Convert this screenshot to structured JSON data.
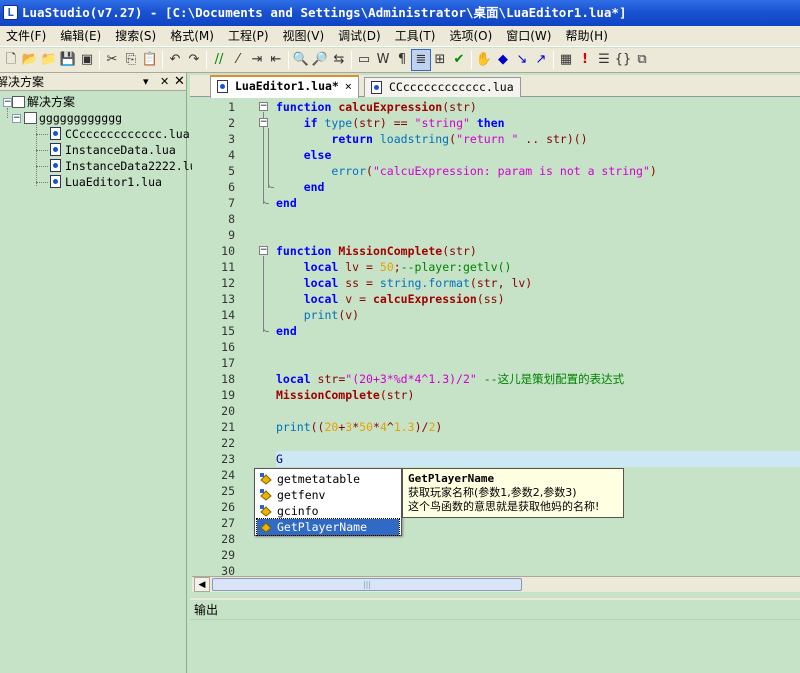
{
  "window": {
    "title": "LuaStudio(v7.27) - [C:\\Documents and Settings\\Administrator\\桌面\\LuaEditor1.lua*]"
  },
  "menu": [
    {
      "label": "文件(F)",
      "name": "menu-file"
    },
    {
      "label": "编辑(E)",
      "name": "menu-edit"
    },
    {
      "label": "搜索(S)",
      "name": "menu-search"
    },
    {
      "label": "格式(M)",
      "name": "menu-format"
    },
    {
      "label": "工程(P)",
      "name": "menu-project"
    },
    {
      "label": "视图(V)",
      "name": "menu-view"
    },
    {
      "label": "调试(D)",
      "name": "menu-debug"
    },
    {
      "label": "工具(T)",
      "name": "menu-tools"
    },
    {
      "label": "选项(O)",
      "name": "menu-options"
    },
    {
      "label": "窗口(W)",
      "name": "menu-window"
    },
    {
      "label": "帮助(H)",
      "name": "menu-help"
    }
  ],
  "toolbar_icons": [
    "new-file-icon",
    "open-folder-icon",
    "open-project-icon",
    "save-icon",
    "save-all-icon",
    "cut-icon",
    "copy-icon",
    "paste-icon",
    "undo-icon",
    "redo-icon",
    "comment-icon",
    "uncomment-icon",
    "indent-icon",
    "outdent-icon",
    "find-icon",
    "find-next-icon",
    "replace-icon",
    "monitor-icon",
    "word-wrap-icon",
    "whitespace-icon",
    "toggle-view-icon",
    "tree-icon",
    "check-icon",
    "hand-icon",
    "breakpoint-icon",
    "step-icon",
    "step-over-icon",
    "stack-icon",
    "exclamation-icon",
    "list-icon",
    "brace-icon",
    "window-icon"
  ],
  "solution_panel": {
    "title": "解决方案",
    "pin": "▾",
    "close": "✕",
    "root_label": "解决方案",
    "project": "gggggggggggg",
    "files": [
      "CCcccccccccccc.lua",
      "InstanceData.lua",
      "InstanceData2222.lua",
      "LuaEditor1.lua"
    ]
  },
  "tabs": [
    {
      "label": "LuaEditor1.lua*",
      "close": "×",
      "active": true
    },
    {
      "label": "CCcccccccccccc.lua",
      "active": false
    }
  ],
  "line_numbers": [
    "1",
    "2",
    "3",
    "4",
    "5",
    "6",
    "7",
    "8",
    "9",
    "10",
    "11",
    "12",
    "13",
    "14",
    "15",
    "16",
    "17",
    "18",
    "19",
    "20",
    "21",
    "22",
    "23",
    "24",
    "25",
    "26",
    "27",
    "28",
    "29",
    "30"
  ],
  "code": {
    "l1": {
      "kw": "function",
      "fn": "calcuExpression",
      "args": "(str)"
    },
    "l2": {
      "kw1": "if",
      "bi": "type",
      "p1": "(str) ",
      "op": "==",
      "sp": " ",
      "str": "\"string\"",
      "kw2": "then"
    },
    "l3": {
      "kw": "return",
      "bi": "loadstring",
      "p1": "(",
      "str": "\"return \"",
      "p2": " .. str)()"
    },
    "l4": {
      "kw": "else"
    },
    "l5": {
      "bi": "error",
      "p1": "(",
      "str": "\"calcuExpression: param is not a string\"",
      "p2": ")"
    },
    "l6": {
      "kw": "end"
    },
    "l7": {
      "kw": "end"
    },
    "l10": {
      "kw": "function",
      "fn": "MissionComplete",
      "args": "(str)"
    },
    "l11": {
      "kw": "local",
      "v": " lv ",
      "op": "=",
      "num": " 50",
      "p": ";",
      "cm": "--player:getlv()"
    },
    "l12": {
      "kw": "local",
      "v": " ss ",
      "op": "=",
      "bi": " string.format",
      "args": "(str, lv)"
    },
    "l13": {
      "kw": "local",
      "v": " v ",
      "op": "=",
      "fn": " calcuExpression",
      "args": "(ss)"
    },
    "l14": {
      "bi": "print",
      "args": "(v)"
    },
    "l15": {
      "kw": "end"
    },
    "l18": {
      "kw": "local",
      "v": " str",
      "op": "=",
      "str": "\"(20+3*%d*4^1.3)/2\"",
      "cm": " --这儿是策划配置的表达式"
    },
    "l19": {
      "fn": "MissionComplete",
      "args": "(str)"
    },
    "l21": {
      "bi": "print",
      "p1": "((",
      "n1": "20",
      "o1": "+",
      "n2": "3",
      "o2": "*",
      "n3": "50",
      "o3": "*",
      "n4": "4",
      "o4": "^",
      "n5": "1.3",
      "p2": ")",
      "o5": "/",
      "n6": "2",
      "p3": ")"
    },
    "l23": {
      "tx": "G"
    }
  },
  "autocomplete": {
    "items": [
      "getmetatable",
      "getfenv",
      "gcinfo",
      "GetPlayerName"
    ],
    "selected_index": 3,
    "tooltip": {
      "name": "GetPlayerName",
      "line1": "获取玩家名称(参数1,参数2,参数3)",
      "line2": "这个鸟函数的意思就是获取他妈的名称!"
    }
  },
  "output": {
    "title": "输出"
  },
  "scroll": {
    "left": "◀",
    "thumb": "|||"
  },
  "colors": {
    "editor_bg": "#c7e3c7",
    "keyword": "#0000ff",
    "function": "#a00000",
    "string": "#d100d1",
    "number": "#e8a000",
    "comment": "#008000",
    "selection": "#316ac5",
    "current_line": "#cde8f4"
  }
}
